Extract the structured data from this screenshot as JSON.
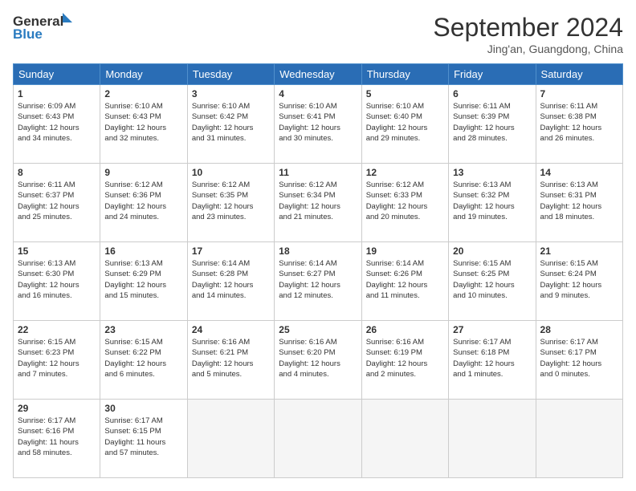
{
  "header": {
    "logo_line1": "General",
    "logo_line2": "Blue",
    "month": "September 2024",
    "location": "Jing'an, Guangdong, China"
  },
  "weekdays": [
    "Sunday",
    "Monday",
    "Tuesday",
    "Wednesday",
    "Thursday",
    "Friday",
    "Saturday"
  ],
  "weeks": [
    [
      {
        "num": "1",
        "rise": "6:09 AM",
        "set": "6:43 PM",
        "hours": "12",
        "mins": "34"
      },
      {
        "num": "2",
        "rise": "6:10 AM",
        "set": "6:43 PM",
        "hours": "12",
        "mins": "32"
      },
      {
        "num": "3",
        "rise": "6:10 AM",
        "set": "6:42 PM",
        "hours": "12",
        "mins": "31"
      },
      {
        "num": "4",
        "rise": "6:10 AM",
        "set": "6:41 PM",
        "hours": "12",
        "mins": "30"
      },
      {
        "num": "5",
        "rise": "6:10 AM",
        "set": "6:40 PM",
        "hours": "12",
        "mins": "29"
      },
      {
        "num": "6",
        "rise": "6:11 AM",
        "set": "6:39 PM",
        "hours": "12",
        "mins": "28"
      },
      {
        "num": "7",
        "rise": "6:11 AM",
        "set": "6:38 PM",
        "hours": "12",
        "mins": "26"
      }
    ],
    [
      {
        "num": "8",
        "rise": "6:11 AM",
        "set": "6:37 PM",
        "hours": "12",
        "mins": "25"
      },
      {
        "num": "9",
        "rise": "6:12 AM",
        "set": "6:36 PM",
        "hours": "12",
        "mins": "24"
      },
      {
        "num": "10",
        "rise": "6:12 AM",
        "set": "6:35 PM",
        "hours": "12",
        "mins": "23"
      },
      {
        "num": "11",
        "rise": "6:12 AM",
        "set": "6:34 PM",
        "hours": "12",
        "mins": "21"
      },
      {
        "num": "12",
        "rise": "6:12 AM",
        "set": "6:33 PM",
        "hours": "12",
        "mins": "20"
      },
      {
        "num": "13",
        "rise": "6:13 AM",
        "set": "6:32 PM",
        "hours": "12",
        "mins": "19"
      },
      {
        "num": "14",
        "rise": "6:13 AM",
        "set": "6:31 PM",
        "hours": "12",
        "mins": "18"
      }
    ],
    [
      {
        "num": "15",
        "rise": "6:13 AM",
        "set": "6:30 PM",
        "hours": "12",
        "mins": "16"
      },
      {
        "num": "16",
        "rise": "6:13 AM",
        "set": "6:29 PM",
        "hours": "12",
        "mins": "15"
      },
      {
        "num": "17",
        "rise": "6:14 AM",
        "set": "6:28 PM",
        "hours": "12",
        "mins": "14"
      },
      {
        "num": "18",
        "rise": "6:14 AM",
        "set": "6:27 PM",
        "hours": "12",
        "mins": "12"
      },
      {
        "num": "19",
        "rise": "6:14 AM",
        "set": "6:26 PM",
        "hours": "12",
        "mins": "11"
      },
      {
        "num": "20",
        "rise": "6:15 AM",
        "set": "6:25 PM",
        "hours": "12",
        "mins": "10"
      },
      {
        "num": "21",
        "rise": "6:15 AM",
        "set": "6:24 PM",
        "hours": "12",
        "mins": "9"
      }
    ],
    [
      {
        "num": "22",
        "rise": "6:15 AM",
        "set": "6:23 PM",
        "hours": "12",
        "mins": "7"
      },
      {
        "num": "23",
        "rise": "6:15 AM",
        "set": "6:22 PM",
        "hours": "12",
        "mins": "6"
      },
      {
        "num": "24",
        "rise": "6:16 AM",
        "set": "6:21 PM",
        "hours": "12",
        "mins": "5"
      },
      {
        "num": "25",
        "rise": "6:16 AM",
        "set": "6:20 PM",
        "hours": "12",
        "mins": "4"
      },
      {
        "num": "26",
        "rise": "6:16 AM",
        "set": "6:19 PM",
        "hours": "12",
        "mins": "2"
      },
      {
        "num": "27",
        "rise": "6:17 AM",
        "set": "6:18 PM",
        "hours": "12",
        "mins": "1"
      },
      {
        "num": "28",
        "rise": "6:17 AM",
        "set": "6:17 PM",
        "hours": "12",
        "mins": "0"
      }
    ],
    [
      {
        "num": "29",
        "rise": "6:17 AM",
        "set": "6:16 PM",
        "hours": "11",
        "mins": "58"
      },
      {
        "num": "30",
        "rise": "6:17 AM",
        "set": "6:15 PM",
        "hours": "11",
        "mins": "57"
      },
      null,
      null,
      null,
      null,
      null
    ]
  ]
}
